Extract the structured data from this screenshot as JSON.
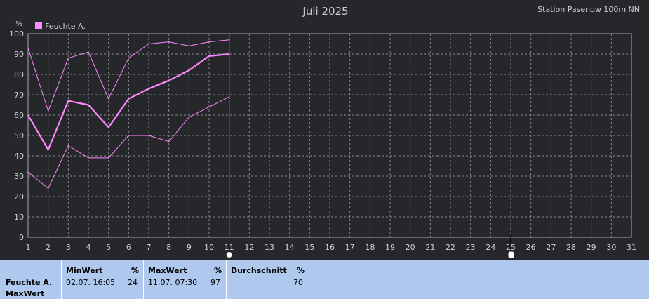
{
  "chart_data": {
    "type": "line",
    "title": "Juli 2025",
    "station": "Station Pasenow 100m NN",
    "unit": "%",
    "legend": "Feuchte A.",
    "legend_color": "#ff88ff",
    "x": [
      1,
      2,
      3,
      4,
      5,
      6,
      7,
      8,
      9,
      10,
      11
    ],
    "xlim": [
      1,
      31
    ],
    "ylim": [
      0,
      100
    ],
    "x_ticks": [
      1,
      2,
      3,
      4,
      5,
      6,
      7,
      8,
      9,
      10,
      11,
      12,
      13,
      14,
      15,
      16,
      17,
      18,
      19,
      20,
      21,
      22,
      23,
      24,
      25,
      26,
      27,
      28,
      29,
      30,
      31
    ],
    "y_ticks": [
      0,
      10,
      20,
      30,
      40,
      50,
      60,
      70,
      80,
      90,
      100
    ],
    "grid": true,
    "series": [
      {
        "role": "max",
        "values": [
          93,
          62,
          88,
          91,
          68,
          88,
          95,
          96,
          94,
          96,
          97
        ]
      },
      {
        "role": "avg",
        "values": [
          60,
          43,
          67,
          65,
          54,
          68,
          73,
          77,
          82,
          89,
          90
        ]
      },
      {
        "role": "min",
        "values": [
          32,
          24,
          45,
          39,
          39,
          50,
          50,
          47,
          59,
          64,
          69
        ]
      }
    ]
  },
  "colors": {
    "background": "#25272b",
    "plot_bg": "#25272b",
    "grid": "#8a8a8a",
    "axis": "#a8a8a8",
    "line": "#ff88ff",
    "text": "#d0d0d0",
    "panel": "#aec8ee"
  },
  "stats": {
    "series_name": "Feuchte A.",
    "series_sub": "MaxWert",
    "min": {
      "label": "MinWert",
      "unit": "%",
      "time": "02.07.  16:05",
      "value": "24"
    },
    "max": {
      "label": "MaxWert",
      "unit": "%",
      "time": "11.07.  07:30",
      "value": "97"
    },
    "avg": {
      "label": "Durchschnitt",
      "unit": "%",
      "value": "70"
    }
  },
  "markers": {
    "current_day": 11,
    "marker_day": 25
  }
}
